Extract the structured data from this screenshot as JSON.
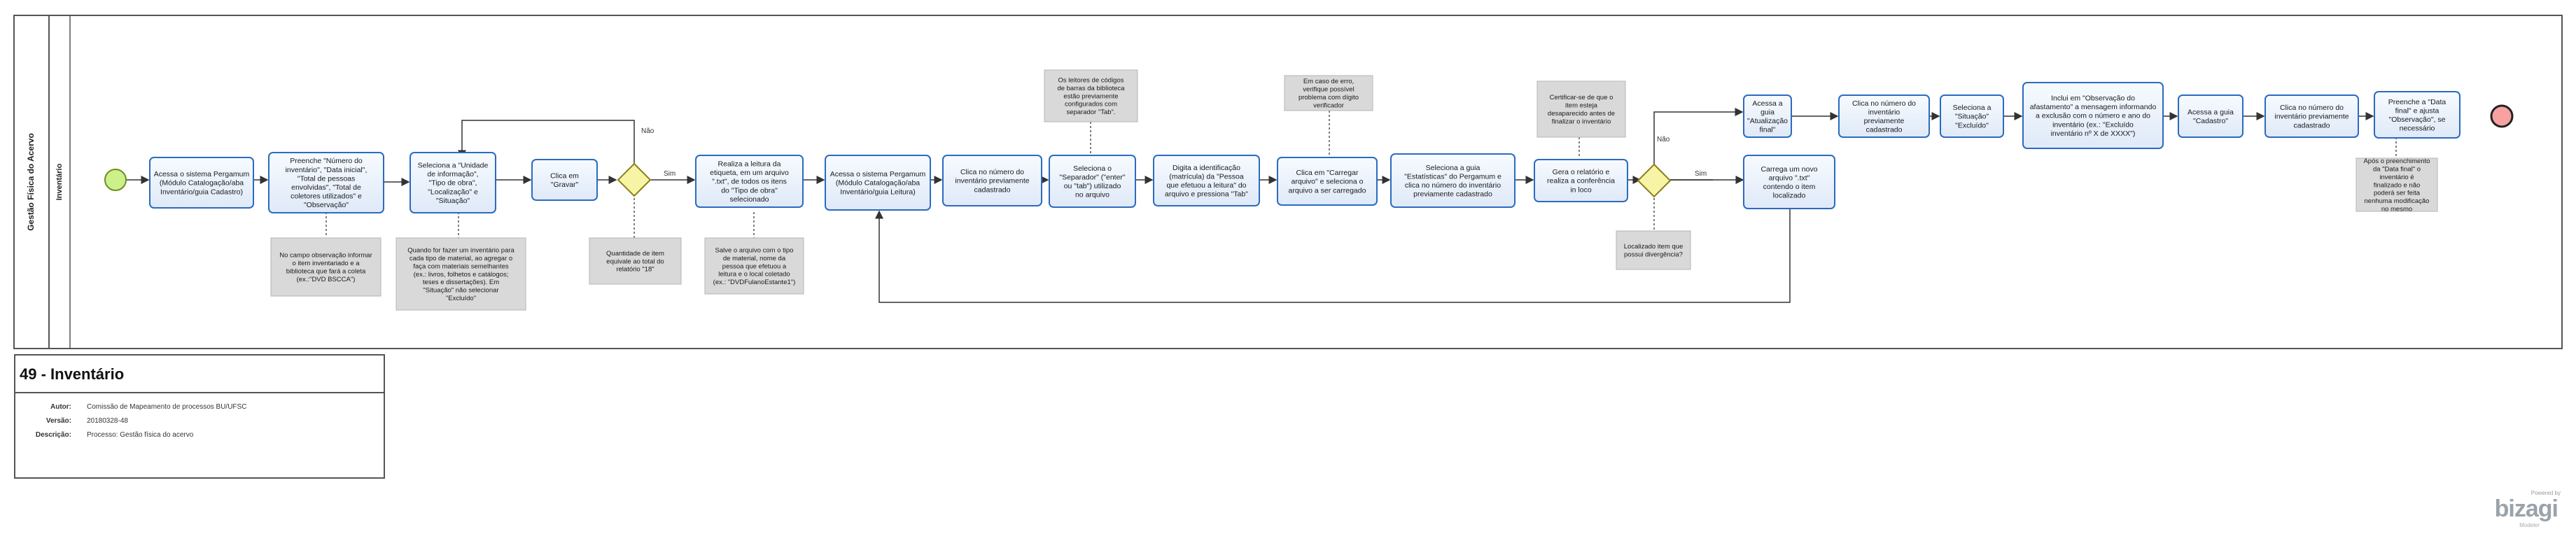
{
  "pool": {
    "name": "Gestão Física do Acervo"
  },
  "lane": {
    "name": "Inventário"
  },
  "tasks": [
    {
      "id": "t1",
      "text": "Acessa o sistema Pergamum (Módulo Catalogação/aba Inventário/guia Cadastro)"
    },
    {
      "id": "t2",
      "text": "Preenche \"Número do inventário\", \"Data inicial\", \"Total de pessoas envolvidas\", \"Total de coletores utilizados\" e \"Observação\""
    },
    {
      "id": "t3",
      "text": "Seleciona a \"Unidade de informação\", \"Tipo de obra\", \"Localização\" e \"Situação\""
    },
    {
      "id": "t4",
      "text": "Clica em \"Gravar\""
    },
    {
      "id": "t5",
      "text": "Realiza a leitura da etiqueta, em um arquivo \".txt\", de todos os itens do \"Tipo de obra\" selecionado"
    },
    {
      "id": "t6",
      "text": "Acessa o sistema Pergamum (Módulo Catalogação/aba Inventário/guia Leitura)"
    },
    {
      "id": "t7",
      "text": "Clica no número do inventário previamente cadastrado"
    },
    {
      "id": "t8",
      "text": "Seleciona o \"Separador\" (\"enter\" ou \"tab\") utilizado no arquivo"
    },
    {
      "id": "t9",
      "text": "Digita a identificação (matrícula) da \"Pessoa que efetuou a leitura\" do arquivo e pressiona \"Tab\""
    },
    {
      "id": "t10",
      "text": "Clica em \"Carregar arquivo\" e seleciona o arquivo a ser carregado"
    },
    {
      "id": "t11",
      "text": "Seleciona a guia \"Estatísticas\" do Pergamum e clica no número do inventário previamente cadastrado"
    },
    {
      "id": "t12",
      "text": "Gera o relatório e realiza a conferência in loco"
    },
    {
      "id": "t13",
      "text": "Acessa a guia \"Atualização final\""
    },
    {
      "id": "t14",
      "text": "Carrega um novo arquivo \".txt\" contendo o item localizado"
    },
    {
      "id": "t15",
      "text": "Clica no número do inventário previamente cadastrado"
    },
    {
      "id": "t16",
      "text": "Seleciona a \"Situação\" \"Excluído\""
    },
    {
      "id": "t17",
      "text": "Inclui em \"Observação do afastamento\" a mensagem informando a exclusão com o número e ano do inventário (ex.: \"Excluído inventário nº X de XXXX\")"
    },
    {
      "id": "t18",
      "text": "Acessa a guia \"Cadastro\""
    },
    {
      "id": "t19",
      "text": "Clica no número do inventário previamente cadastrado"
    },
    {
      "id": "t20",
      "text": "Preenche a \"Data final\" e ajusta \"Observação\", se necessário"
    }
  ],
  "annotations": [
    {
      "id": "a1",
      "text": "No campo observação informar o item inventariado e a biblioteca que fará a coleta (ex.:\"DVD BSCCA\")"
    },
    {
      "id": "a2",
      "text": "Quando for fazer um inventário para cada tipo de material, ao agregar o faça com materiais semelhantes (ex.: livros, folhetos e catálogos; teses e dissertações). Em \"Situação\" não selecionar \"Excluído\""
    },
    {
      "id": "a3",
      "text": "Quantidade de item equivale ao total do relatório \"18\""
    },
    {
      "id": "a4",
      "text": "Salve o arquivo com o tipo de material, nome da pessoa que efetuou a leitura e o local coletado (ex.: \"DVDFulanoEstante1\")"
    },
    {
      "id": "a5",
      "text": "Os leitores de códigos de barras da biblioteca estão previamente configurados com separador \"Tab\"."
    },
    {
      "id": "a6",
      "text": "Em caso de erro, verifique possível problema com dígito verificador"
    },
    {
      "id": "a7",
      "text": "Certificar-se de que o item esteja desaparecido antes de finalizar o inventário"
    },
    {
      "id": "a8",
      "text": "Localizado item que possui divergência?"
    },
    {
      "id": "a9",
      "text": "Após o preenchimento da \"Data final\" o inventário é finalizado e não poderá ser feita nenhuma modificação no mesmo"
    }
  ],
  "labels": {
    "g1_no": "Não",
    "g1_yes": "Sim",
    "g2_no": "Não",
    "g2_yes": "Sim"
  },
  "info": {
    "title": "49 - Inventário",
    "author_key": "Autor:",
    "author_val": "Comissão de Mapeamento de processos BU/UFSC",
    "version_key": "Versão:",
    "version_val": "20180328-48",
    "desc_key": "Descrição:",
    "desc_val": "Processo: Gestão física do acervo"
  },
  "brand": {
    "powered": "Powered by",
    "name": "bizagi",
    "sub": "Modeler"
  },
  "colors": {
    "task_fill": "#e9f1fb",
    "task_stroke": "#2b6bbf",
    "annotation_fill": "#d9d9d9",
    "start": "#ccf08a",
    "end": "#f7a1a1",
    "gateway": "#f8f4a6"
  }
}
